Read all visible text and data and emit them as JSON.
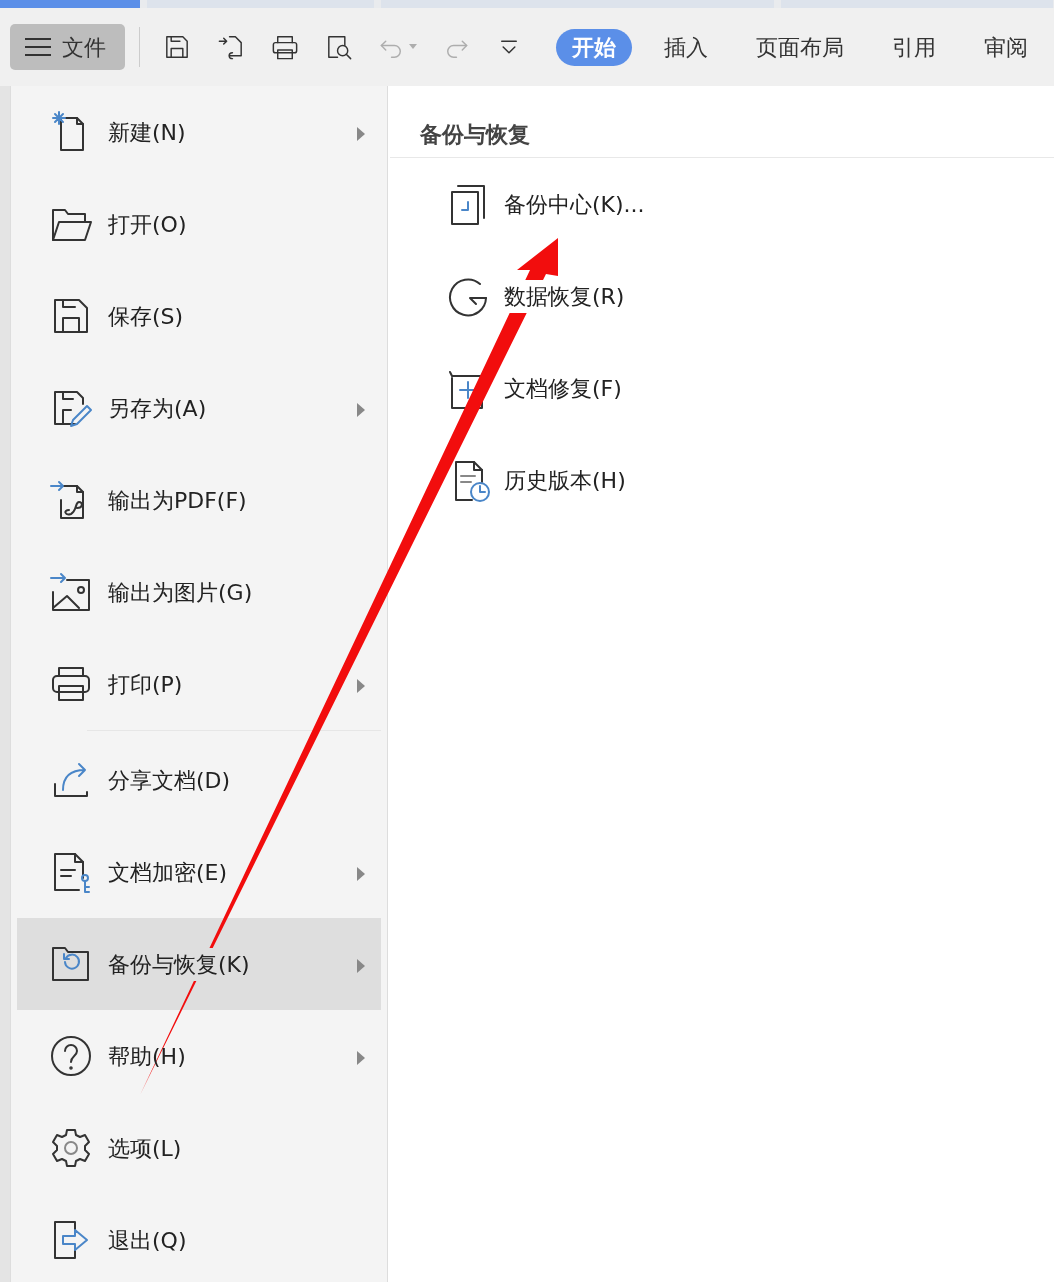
{
  "doc_tabs": [
    {
      "selected": true
    },
    {
      "selected": false
    },
    {
      "selected": false
    },
    {
      "selected": false
    }
  ],
  "file_button": {
    "label": "文件"
  },
  "toolbar": [
    {
      "disabled": false
    },
    {
      "disabled": false
    },
    {
      "disabled": false
    },
    {
      "disabled": false
    },
    {
      "disabled": true
    },
    {
      "disabled": true
    },
    {
      "disabled": false
    }
  ],
  "ribbon_tabs": [
    {
      "label": "开始",
      "selected": true
    },
    {
      "label": "插入",
      "selected": false
    },
    {
      "label": "页面布局",
      "selected": false
    },
    {
      "label": "引用",
      "selected": false
    },
    {
      "label": "审阅",
      "selected": false
    }
  ],
  "file_menu": [
    {
      "label": "新建(N)",
      "submenu": true,
      "selected": false,
      "separator_after": false
    },
    {
      "label": "打开(O)",
      "submenu": false,
      "selected": false,
      "separator_after": false
    },
    {
      "label": "保存(S)",
      "submenu": false,
      "selected": false,
      "separator_after": false
    },
    {
      "label": "另存为(A)",
      "submenu": true,
      "selected": false,
      "separator_after": false
    },
    {
      "label": "输出为PDF(F)",
      "submenu": false,
      "selected": false,
      "separator_after": false
    },
    {
      "label": "输出为图片(G)",
      "submenu": false,
      "selected": false,
      "separator_after": false
    },
    {
      "label": "打印(P)",
      "submenu": true,
      "selected": false,
      "separator_after": true
    },
    {
      "label": "分享文档(D)",
      "submenu": false,
      "selected": false,
      "separator_after": false
    },
    {
      "label": "文档加密(E)",
      "submenu": true,
      "selected": false,
      "separator_after": false
    },
    {
      "label": "备份与恢复(K)",
      "submenu": true,
      "selected": true,
      "separator_after": false
    },
    {
      "label": "帮助(H)",
      "submenu": true,
      "selected": false,
      "separator_after": false
    },
    {
      "label": "选项(L)",
      "submenu": false,
      "selected": false,
      "separator_after": false
    },
    {
      "label": "退出(Q)",
      "submenu": false,
      "selected": false,
      "separator_after": false
    }
  ],
  "submenu": {
    "title": "备份与恢复",
    "items": [
      {
        "label": "备份中心(K)..."
      },
      {
        "label": "数据恢复(R)"
      },
      {
        "label": "文档修复(F)"
      },
      {
        "label": "历史版本(H)"
      }
    ]
  }
}
